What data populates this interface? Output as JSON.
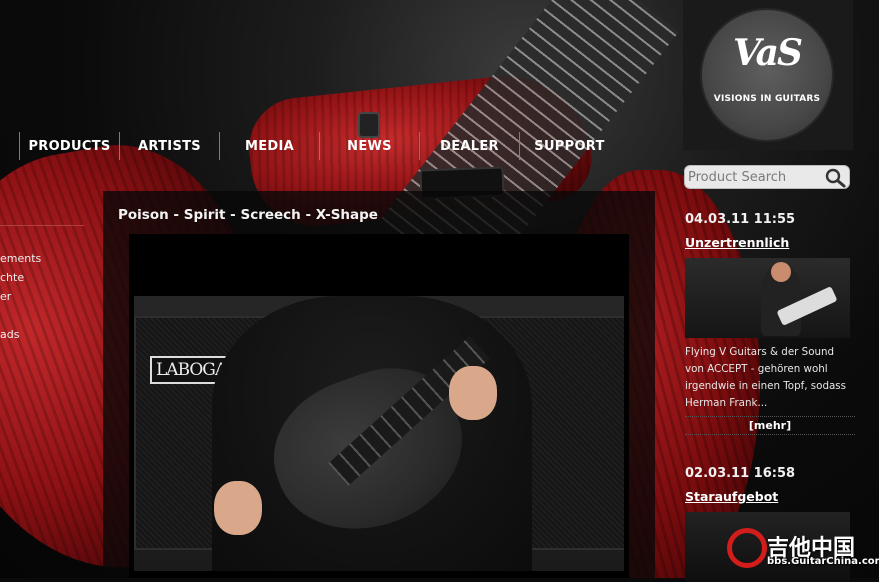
{
  "nav": {
    "items": [
      {
        "label": "PRODUCTS"
      },
      {
        "label": "ARTISTS"
      },
      {
        "label": "MEDIA"
      },
      {
        "label": "NEWS"
      },
      {
        "label": "DEALER"
      },
      {
        "label": "SUPPORT"
      }
    ]
  },
  "left_sidebar": {
    "links": [
      "ements",
      "chte",
      "er",
      "ads"
    ]
  },
  "main": {
    "title": "Poison - Spirit - Screech - X-Shape",
    "video": {
      "amp_brand": "LABOGA"
    }
  },
  "brand": {
    "logo_mark": "VaS",
    "logo_text": "VISIONS IN GUITARS"
  },
  "search": {
    "placeholder": "Product Search",
    "icon": "search-icon"
  },
  "news": [
    {
      "date": "04.03.11 11:55",
      "title": "Unzertrennlich",
      "text": "Flying V Guitars & der Sound von ACCEPT - gehören wohl irgendwie in einen Topf, sodass Herman Frank...",
      "more": "[mehr]"
    },
    {
      "date": "02.03.11 16:58",
      "title": "Staraufgebot"
    }
  ],
  "watermark": {
    "chinese": "吉他中国",
    "url": "bbs.GuitarChina.com"
  },
  "colors": {
    "nav_divider": "#c26a2a",
    "accent_red": "#b01e20"
  }
}
